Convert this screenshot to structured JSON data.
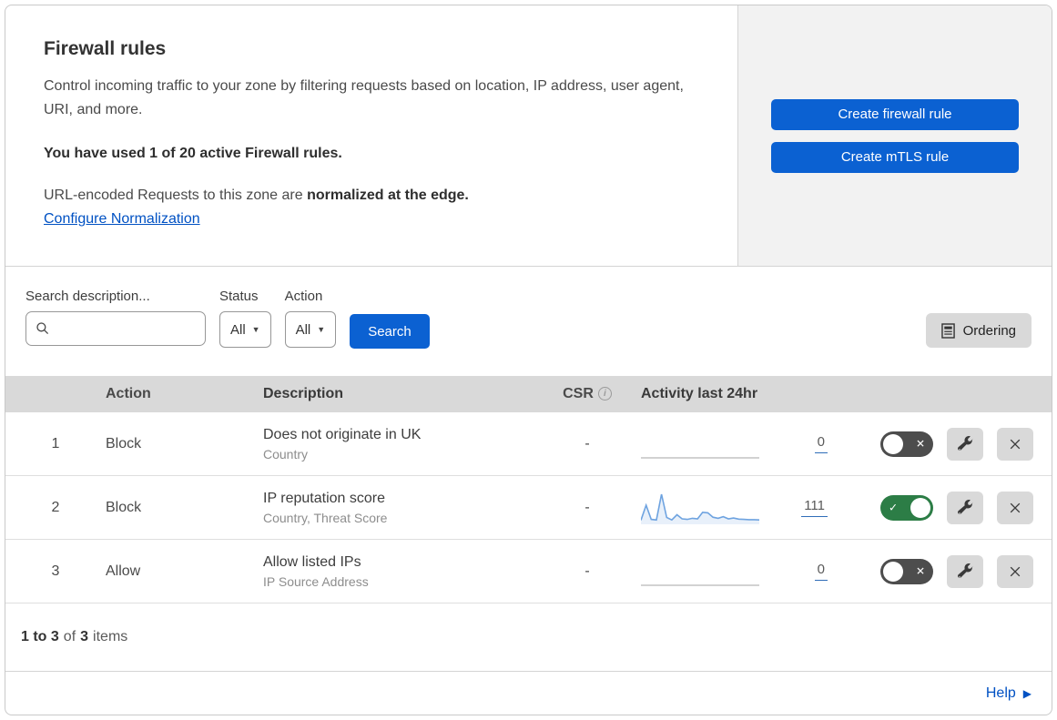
{
  "header": {
    "title": "Firewall rules",
    "description": "Control incoming traffic to your zone by filtering requests based on location, IP address, user agent, URI, and more.",
    "usage_bold": "You have used 1 of 20 active Firewall rules.",
    "norm_prefix": "URL-encoded Requests to this zone are",
    "norm_bold": "normalized at the edge.",
    "norm_link": "Configure Normalization",
    "buttons": {
      "create_firewall": "Create firewall rule",
      "create_mtls": "Create mTLS rule"
    }
  },
  "filters": {
    "search_label": "Search description...",
    "search_value": "",
    "status_label": "Status",
    "status_value": "All",
    "action_label": "Action",
    "action_value": "All",
    "search_button": "Search",
    "ordering_button": "Ordering"
  },
  "table": {
    "columns": {
      "action": "Action",
      "description": "Description",
      "csr": "CSR",
      "activity": "Activity last 24hr"
    },
    "rows": [
      {
        "priority": "1",
        "action": "Block",
        "description": "Does not originate in UK",
        "fields": "Country",
        "csr": "-",
        "activity_count": "0",
        "enabled": false,
        "sparkline": [
          0,
          0,
          0,
          0,
          0,
          0,
          0,
          0,
          0,
          0,
          0,
          0,
          0,
          0,
          0,
          0,
          0,
          0,
          0,
          0,
          0,
          0,
          0,
          0
        ]
      },
      {
        "priority": "2",
        "action": "Block",
        "description": "IP reputation score",
        "fields": "Country, Threat Score",
        "csr": "-",
        "activity_count": "111",
        "enabled": true,
        "sparkline": [
          5,
          60,
          8,
          6,
          100,
          15,
          6,
          25,
          10,
          8,
          12,
          10,
          34,
          32,
          16,
          12,
          18,
          10,
          13,
          9,
          8,
          7,
          7,
          6
        ]
      },
      {
        "priority": "3",
        "action": "Allow",
        "description": "Allow listed IPs",
        "fields": "IP Source Address",
        "csr": "-",
        "activity_count": "0",
        "enabled": false,
        "sparkline": [
          0,
          0,
          0,
          0,
          0,
          0,
          0,
          0,
          0,
          0,
          0,
          0,
          0,
          0,
          0,
          0,
          0,
          0,
          0,
          0,
          0,
          0,
          0,
          0
        ]
      }
    ]
  },
  "pagination": {
    "range": "1 to 3",
    "of": "of",
    "total": "3",
    "items": "items"
  },
  "footer": {
    "help": "Help"
  },
  "icons": {
    "info": "i",
    "caret": "▼",
    "check": "✓",
    "close": "✕",
    "help_arrow": "▶"
  },
  "colors": {
    "primary_blue": "#0b61d2",
    "link_blue": "#0051c3",
    "toggle_on_green": "#2c7d46",
    "toggle_off_gray": "#4d4d4d",
    "table_header_gray": "#d9d9d9",
    "side_panel_gray": "#f2f2f2",
    "sparkline_blue": "#6ea3e0"
  }
}
